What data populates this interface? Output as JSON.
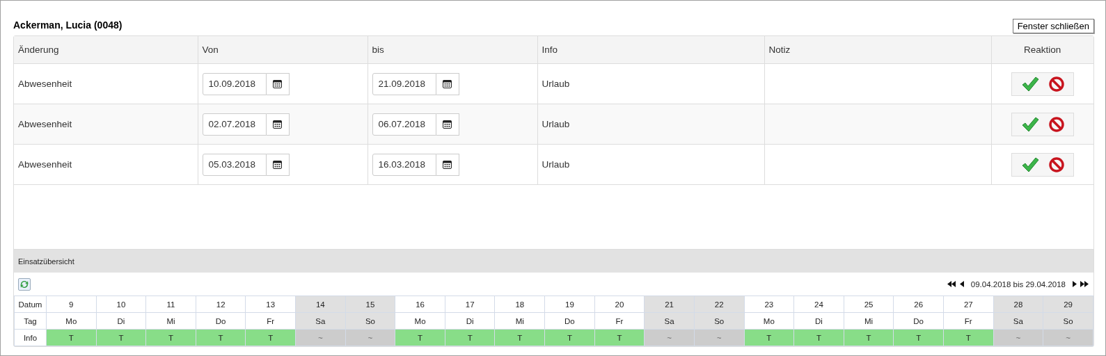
{
  "title": "Ackerman, Lucia (0048)",
  "close_button": "Fenster schließen",
  "table": {
    "columns": [
      "Änderung",
      "Von",
      "bis",
      "Info",
      "Notiz",
      "Reaktion"
    ],
    "rows": [
      {
        "change": "Abwesenheit",
        "from": "10.09.2018",
        "to": "21.09.2018",
        "info": "Urlaub"
      },
      {
        "change": "Abwesenheit",
        "from": "02.07.2018",
        "to": "06.07.2018",
        "info": "Urlaub"
      },
      {
        "change": "Abwesenheit",
        "from": "05.03.2018",
        "to": "16.03.2018",
        "info": "Urlaub"
      }
    ]
  },
  "overview": {
    "title": "Einsatzübersicht",
    "range": "09.04.2018 bis 29.04.2018",
    "row_labels": [
      "Datum",
      "Tag",
      "Info"
    ],
    "days": [
      {
        "date": "9",
        "day": "Mo",
        "info": "T",
        "kind": "workday"
      },
      {
        "date": "10",
        "day": "Di",
        "info": "T",
        "kind": "workday"
      },
      {
        "date": "11",
        "day": "Mi",
        "info": "T",
        "kind": "workday"
      },
      {
        "date": "12",
        "day": "Do",
        "info": "T",
        "kind": "workday"
      },
      {
        "date": "13",
        "day": "Fr",
        "info": "T",
        "kind": "workday"
      },
      {
        "date": "14",
        "day": "Sa",
        "info": "~",
        "kind": "weekend"
      },
      {
        "date": "15",
        "day": "So",
        "info": "~",
        "kind": "weekend"
      },
      {
        "date": "16",
        "day": "Mo",
        "info": "T",
        "kind": "workday"
      },
      {
        "date": "17",
        "day": "Di",
        "info": "T",
        "kind": "workday"
      },
      {
        "date": "18",
        "day": "Mi",
        "info": "T",
        "kind": "workday"
      },
      {
        "date": "19",
        "day": "Do",
        "info": "T",
        "kind": "workday"
      },
      {
        "date": "20",
        "day": "Fr",
        "info": "T",
        "kind": "workday"
      },
      {
        "date": "21",
        "day": "Sa",
        "info": "~",
        "kind": "weekend"
      },
      {
        "date": "22",
        "day": "So",
        "info": "~",
        "kind": "weekend"
      },
      {
        "date": "23",
        "day": "Mo",
        "info": "T",
        "kind": "workday"
      },
      {
        "date": "24",
        "day": "Di",
        "info": "T",
        "kind": "workday"
      },
      {
        "date": "25",
        "day": "Mi",
        "info": "T",
        "kind": "workday"
      },
      {
        "date": "26",
        "day": "Do",
        "info": "T",
        "kind": "workday"
      },
      {
        "date": "27",
        "day": "Fr",
        "info": "T",
        "kind": "workday"
      },
      {
        "date": "28",
        "day": "Sa",
        "info": "~",
        "kind": "weekend"
      },
      {
        "date": "29",
        "day": "So",
        "info": "~",
        "kind": "weekend"
      }
    ]
  }
}
